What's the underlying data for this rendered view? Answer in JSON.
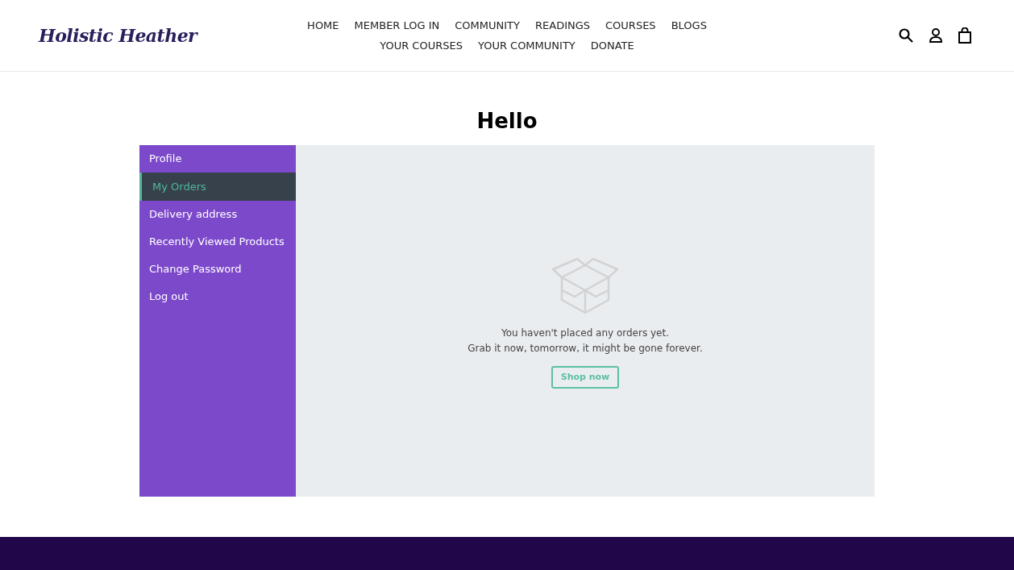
{
  "header": {
    "logo": "Holistic Heather",
    "nav_rows": [
      [
        "HOME",
        "MEMBER LOG IN",
        "COMMUNITY",
        "READINGS",
        "COURSES",
        "BLOGS"
      ],
      [
        "YOUR COURSES",
        "YOUR COMMUNITY",
        "DONATE"
      ]
    ]
  },
  "title": "Hello",
  "sidebar": {
    "items": [
      {
        "label": "Profile",
        "selected": false
      },
      {
        "label": "My Orders",
        "selected": true
      },
      {
        "label": "Delivery address",
        "selected": false
      },
      {
        "label": "Recently Viewed Products",
        "selected": false
      },
      {
        "label": "Change Password",
        "selected": false
      },
      {
        "label": "Log out",
        "selected": false
      }
    ]
  },
  "empty_state": {
    "lines": [
      "You haven't placed any orders yet.",
      "Grab it now, tomorrow, it might be gone forever."
    ],
    "button": "Shop now"
  }
}
